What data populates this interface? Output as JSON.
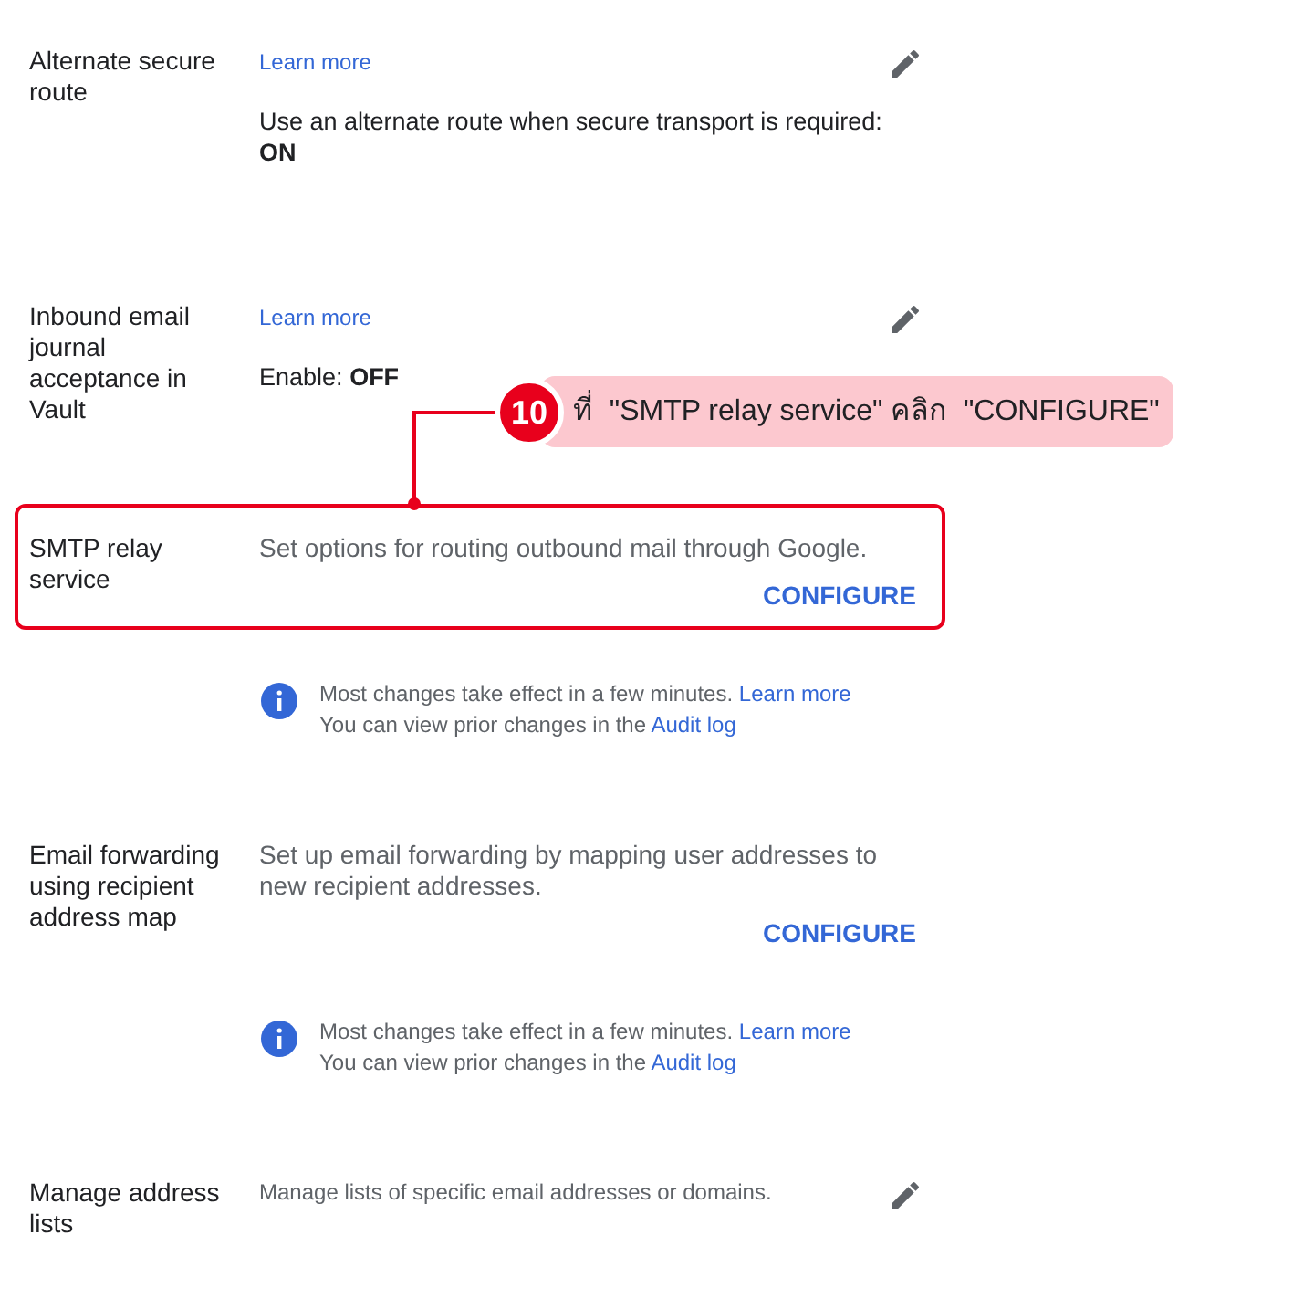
{
  "sections": [
    {
      "kind": "status",
      "label": "Alternate secure route",
      "link": "Learn more",
      "description": "Use an alternate route when secure transport is required:",
      "value": "ON",
      "highlighted": false
    },
    {
      "kind": "status",
      "label": "Inbound email journal acceptance in Vault",
      "link": "Learn more",
      "description": "Enable:",
      "value": "OFF",
      "highlighted": false
    },
    {
      "kind": "configure",
      "label": "SMTP relay service",
      "description": "Set options for routing outbound mail through Google.",
      "button": "CONFIGURE",
      "highlighted": true
    },
    {
      "kind": "info",
      "text": "Most changes take effect in a few minutes.",
      "link": "Learn more",
      "text2": "You can view prior changes in the",
      "link2": "Audit log"
    },
    {
      "kind": "configure",
      "label": "Email forwarding using recipient address map",
      "description": "Set up email forwarding by mapping user addresses to new recipient addresses.",
      "button": "CONFIGURE",
      "highlighted": false
    },
    {
      "kind": "info",
      "text": "Most changes take effect in a few minutes.",
      "link": "Learn more",
      "text2": "You can view prior changes in the",
      "link2": "Audit log"
    },
    {
      "kind": "edit",
      "label": "Manage address lists",
      "description": "Manage lists of specific email addresses or domains.",
      "highlighted": false
    }
  ],
  "annotation": {
    "step": "10",
    "text": "ที่  \"SMTP relay service\" คลิก  \"CONFIGURE\""
  }
}
